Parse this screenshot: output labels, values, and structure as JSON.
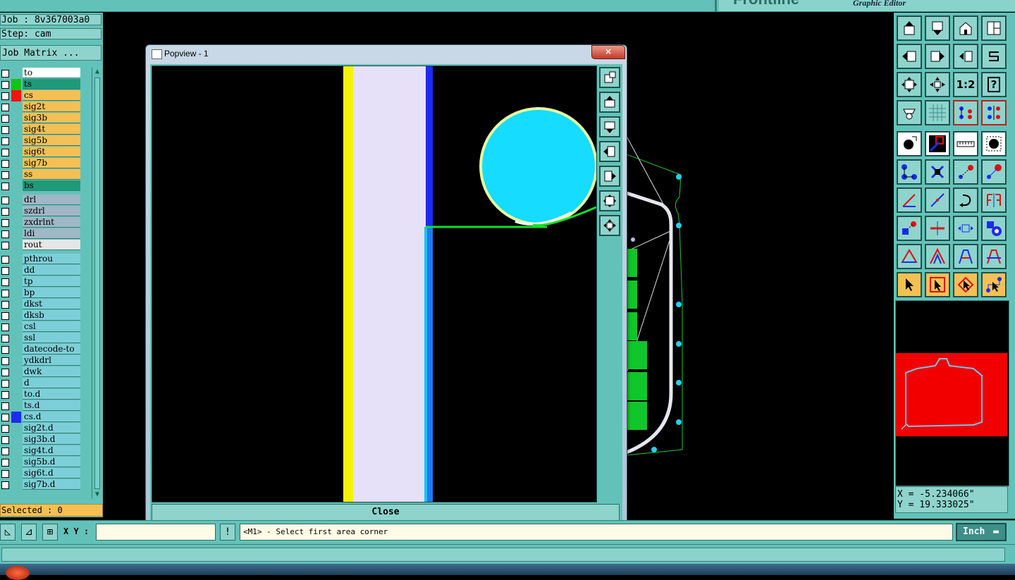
{
  "app": {
    "logo_text": "Frontline",
    "subtitle": "Graphic Editor"
  },
  "left": {
    "job": "Job : 8v367003a0",
    "step": "Step: cam",
    "job_matrix": "Job Matrix ...",
    "selected": "Selected : 0",
    "layers": [
      {
        "name": "to",
        "bg": "#ffffff",
        "swatch": ""
      },
      {
        "name": "ts",
        "bg": "#1f9a78",
        "swatch": "#14c21b"
      },
      {
        "name": "cs",
        "bg": "#f4c054",
        "swatch": "#ff1010"
      },
      {
        "name": "sig2t",
        "bg": "#f4c054",
        "swatch": ""
      },
      {
        "name": "sig3b",
        "bg": "#f4c054",
        "swatch": ""
      },
      {
        "name": "sig4t",
        "bg": "#f4c054",
        "swatch": ""
      },
      {
        "name": "sig5b",
        "bg": "#f4c054",
        "swatch": ""
      },
      {
        "name": "sig6t",
        "bg": "#f4c054",
        "swatch": ""
      },
      {
        "name": "sig7b",
        "bg": "#f4c054",
        "swatch": ""
      },
      {
        "name": "ss",
        "bg": "#f4c054",
        "swatch": ""
      },
      {
        "name": "bs",
        "bg": "#1f9a78",
        "swatch": ""
      },
      {
        "name": "drl",
        "bg": "#9fb7c6",
        "swatch": ""
      },
      {
        "name": "szdrl",
        "bg": "#9fb7c6",
        "swatch": ""
      },
      {
        "name": "zxdrlnt",
        "bg": "#9fb7c6",
        "swatch": ""
      },
      {
        "name": "ldi",
        "bg": "#9fb7c6",
        "swatch": ""
      },
      {
        "name": "rout",
        "bg": "#e6e6e6",
        "swatch": ""
      },
      {
        "name": "pthrou",
        "bg": "#7ccfd8",
        "swatch": ""
      },
      {
        "name": "dd",
        "bg": "#7ccfd8",
        "swatch": ""
      },
      {
        "name": "tp",
        "bg": "#7ccfd8",
        "swatch": ""
      },
      {
        "name": "bp",
        "bg": "#7ccfd8",
        "swatch": ""
      },
      {
        "name": "dkst",
        "bg": "#7ccfd8",
        "swatch": ""
      },
      {
        "name": "dksb",
        "bg": "#7ccfd8",
        "swatch": ""
      },
      {
        "name": "csl",
        "bg": "#7ccfd8",
        "swatch": ""
      },
      {
        "name": "ssl",
        "bg": "#7ccfd8",
        "swatch": ""
      },
      {
        "name": "datecode-to",
        "bg": "#7ccfd8",
        "swatch": ""
      },
      {
        "name": "ydkdrl",
        "bg": "#7ccfd8",
        "swatch": ""
      },
      {
        "name": "dwk",
        "bg": "#7ccfd8",
        "swatch": ""
      },
      {
        "name": "d",
        "bg": "#7ccfd8",
        "swatch": ""
      },
      {
        "name": "to.d",
        "bg": "#7ccfd8",
        "swatch": ""
      },
      {
        "name": "ts.d",
        "bg": "#7ccfd8",
        "swatch": ""
      },
      {
        "name": "cs.d",
        "bg": "#7ccfd8",
        "swatch": "#1b2cf0"
      },
      {
        "name": "sig2t.d",
        "bg": "#7ccfd8",
        "swatch": ""
      },
      {
        "name": "sig3b.d",
        "bg": "#7ccfd8",
        "swatch": ""
      },
      {
        "name": "sig4t.d",
        "bg": "#7ccfd8",
        "swatch": ""
      },
      {
        "name": "sig5b.d",
        "bg": "#7ccfd8",
        "swatch": ""
      },
      {
        "name": "sig6t.d",
        "bg": "#7ccfd8",
        "swatch": ""
      },
      {
        "name": "sig7b.d",
        "bg": "#7ccfd8",
        "swatch": ""
      }
    ]
  },
  "popview": {
    "title": "Popview - 1",
    "close_x": "×",
    "close_label": "Close"
  },
  "bottom": {
    "xy_label": "X Y :",
    "xy_value": "",
    "status": "<M1> - Select first area corner",
    "unit": "Inch"
  },
  "coords": {
    "x": "X = -5.234066\"",
    "y": "Y = 19.333025\""
  },
  "right_toolbar": {
    "ratio_label": "1:2",
    "help_label": "?"
  }
}
